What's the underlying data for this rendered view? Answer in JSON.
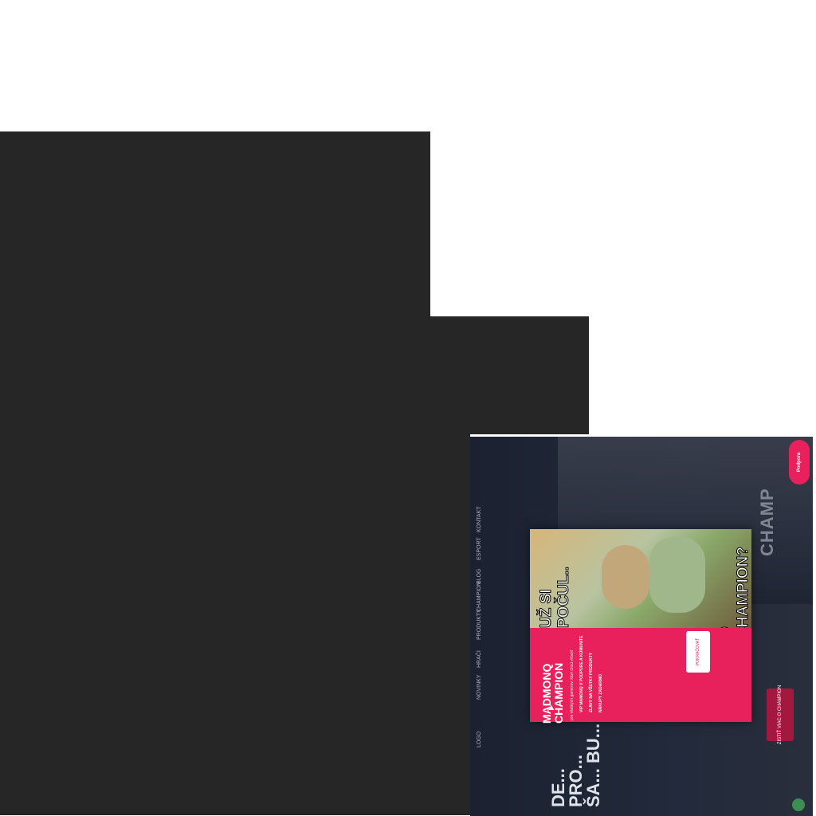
{
  "popup": {
    "meme_top": "UŽ SI POČUL..",
    "meme_bottom": "O CHAMPION?",
    "title": "MADMONQ CHAMPION",
    "subtitle": "pre všetkých gamerov, ktorí chcú víťaziť",
    "list": [
      "VIP MAMONQ V PODPORE A KOMUNITE",
      "ZĽAVY NA VŠETKY PRODUKTY",
      "NÁKUPY ZADARMO"
    ],
    "button_label": "POKRAČOVAŤ"
  },
  "page": {
    "support_label": "Podpora",
    "headline": "DE... PRO... ŠA... BU...",
    "cta_label": "ZISTIŤ VIAC O CHAMPION",
    "hero_text": "CHAMP",
    "nav_items": [
      "LOGO",
      "NOVINKY",
      "HRAČI",
      "PRODUKTY",
      "CHAMPION",
      "BLOG",
      "ESPORT",
      "KONTAKT"
    ]
  }
}
